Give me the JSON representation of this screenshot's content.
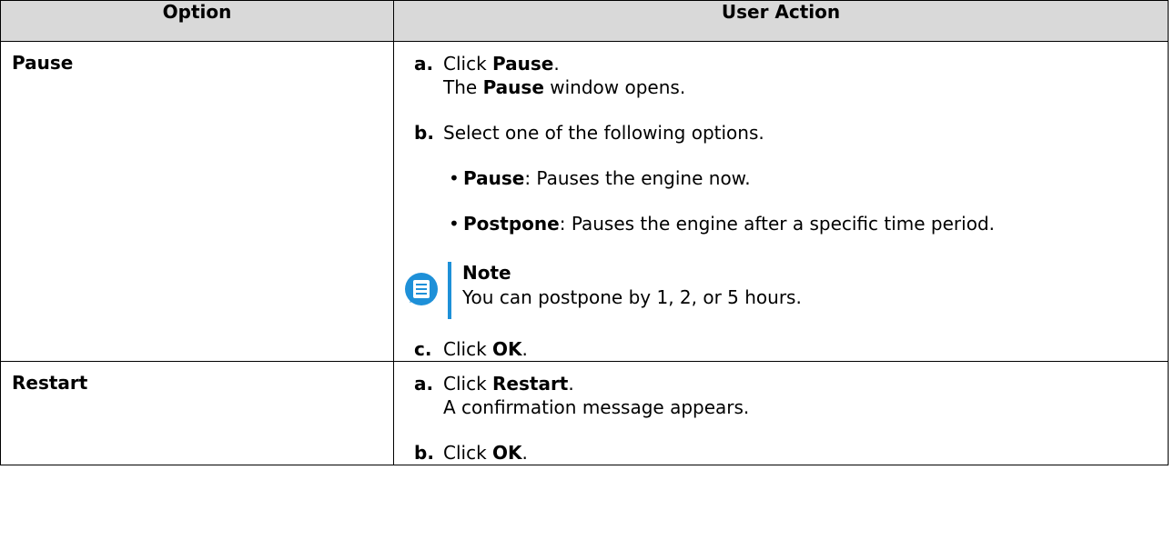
{
  "table": {
    "headers": {
      "option": "Option",
      "action": "User Action"
    },
    "rows": [
      {
        "option": "Pause",
        "steps": {
          "a": {
            "letter": "a.",
            "pre": "Click ",
            "bold": "Pause",
            "post": ".",
            "line2_pre": "The ",
            "line2_bold": "Pause",
            "line2_post": " window opens."
          },
          "b": {
            "letter": "b.",
            "text": "Select one of the following options."
          },
          "bullets": [
            {
              "dot": "•",
              "bold": "Pause",
              "text": ": Pauses the engine now."
            },
            {
              "dot": "•",
              "bold": "Postpone",
              "text": ": Pauses the engine after a specific time period."
            }
          ],
          "note": {
            "title": "Note",
            "text": "You can postpone by 1, 2, or 5 hours.",
            "icon": "note-icon",
            "color": "#1e90d8"
          },
          "c": {
            "letter": "c.",
            "pre": "Click ",
            "bold": "OK",
            "post": "."
          }
        }
      },
      {
        "option": "Restart",
        "steps": {
          "a": {
            "letter": "a.",
            "pre": "Click ",
            "bold": "Restart",
            "post": ".",
            "line2": "A confirmation message appears."
          },
          "b": {
            "letter": "b.",
            "pre": "Click ",
            "bold": "OK",
            "post": "."
          }
        }
      }
    ]
  }
}
